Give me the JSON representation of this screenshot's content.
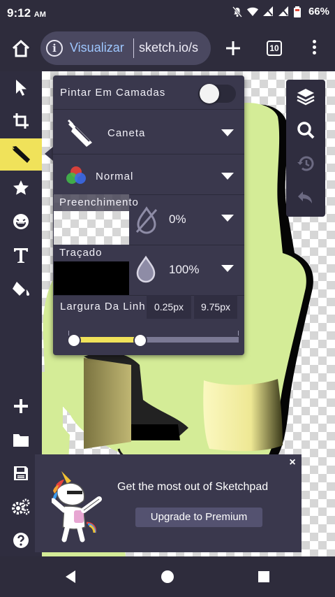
{
  "status_bar": {
    "time": "9:12",
    "ampm": "AM",
    "battery": "66%",
    "icons": [
      "mute-icon",
      "wifi-icon",
      "signal-icon",
      "no-signal-icon",
      "battery-icon"
    ]
  },
  "browser": {
    "mode_label": "Visualizar",
    "url": "sketch.io/s",
    "tab_count": "10"
  },
  "left_toolbar": {
    "tools": [
      "select-icon",
      "crop-icon",
      "pen-icon",
      "star-icon",
      "emoji-icon",
      "text-icon",
      "fill-bucket-icon",
      "add-icon",
      "folder-icon",
      "save-icon",
      "settings-icon",
      "help-icon"
    ],
    "active_tool": "pen-icon"
  },
  "right_toolbar": {
    "tools": [
      "layers-icon",
      "search-icon",
      "history-icon",
      "undo-icon"
    ]
  },
  "brush_panel": {
    "layers_label": "Pintar Em Camadas",
    "layers_enabled": false,
    "brush_label": "Caneta",
    "blend_label": "Normal",
    "fill_label": "Preenchimento",
    "fill_opacity": "0%",
    "stroke_label": "Traçado",
    "stroke_opacity": "100%",
    "width_label": "Largura Da Linh",
    "width_min": "0.25px",
    "width_max": "9.75px",
    "accent_color": "#f0e25a"
  },
  "banner": {
    "pitch": "Get the most out of Sketchpad",
    "cta": "Upgrade to Premium",
    "close": "×"
  },
  "colors": {
    "chrome": "#2f2d3f",
    "panel": "#3a384d",
    "drawing_green": "#d4ec97",
    "drawing_yellow": "#f7f3a6"
  }
}
